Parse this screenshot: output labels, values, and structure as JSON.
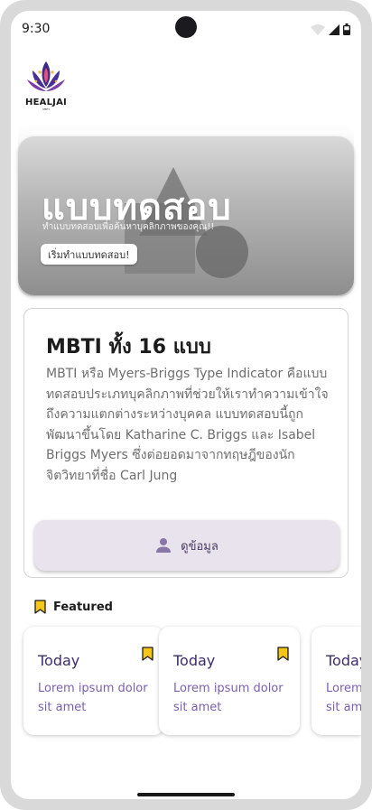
{
  "status_bar": {
    "time": "9:30"
  },
  "logo": {
    "name": "HEALJAI",
    "sub": "MBTI"
  },
  "hero": {
    "title": "แบบทดสอบ",
    "subtitle": "ทำแบบทดสอบเพื่อค้นหาบุคลิกภาพของคุณ!!",
    "button_label": "เริ่มทำแบบทดสอบ!"
  },
  "mbti": {
    "title": "MBTI ทั้ง 16 แบบ",
    "description": "MBTI หรือ Myers-Briggs Type Indicator คือแบบทดสอบประเภทบุคลิกภาพที่ช่วยให้เราทำความเข้าใจถึงความแตกต่างระหว่างบุคคล แบบทดสอบนี้ถูกพัฒนาขึ้นโดย Katharine C. Briggs และ Isabel Briggs Myers ซึ่งต่อยอดมาจากทฤษฎีของนักจิตวิทยาที่ชื่อ Carl Jung",
    "button_label": "ดูข้อมูล",
    "button_icon": "person-icon"
  },
  "featured": {
    "label": "Featured",
    "icon": "bookmark-icon",
    "cards": [
      {
        "title": "Today",
        "body": "Lorem ipsum dolor sit amet"
      },
      {
        "title": "Today",
        "body": "Lorem ipsum dolor sit amet"
      },
      {
        "title": "Today",
        "body": "Lorem ipsum dolor sit amet"
      }
    ]
  },
  "colors": {
    "accent": "#7a5fb0",
    "button_bg": "#e9e3ee",
    "bookmark": "#f5c518",
    "title_purple": "#3d2c6b"
  }
}
